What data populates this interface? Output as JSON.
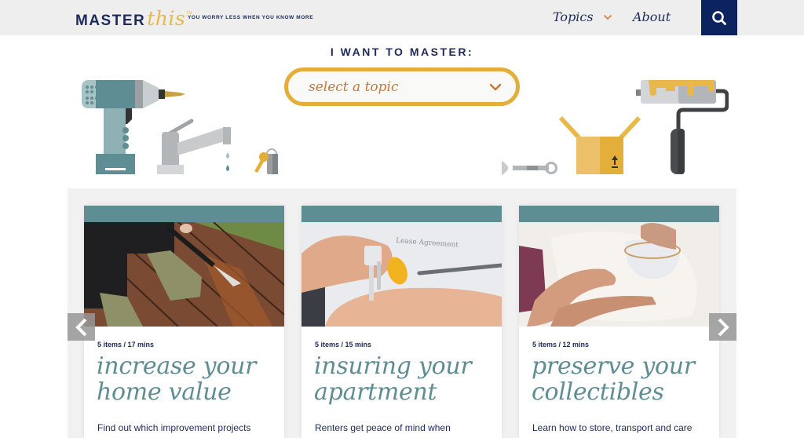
{
  "header": {
    "logo_master": "MASTER",
    "logo_this": "this",
    "logo_tm": "TM",
    "tagline": "YOU WORRY LESS WHEN YOU KNOW MORE",
    "nav": {
      "topics_label": "Topics",
      "about_label": "About"
    },
    "search_icon": "search-icon"
  },
  "hero": {
    "heading": "I WANT TO MASTER:",
    "select_placeholder": "select a topic",
    "illustrations": [
      "drill",
      "faucet",
      "keys",
      "wrench",
      "box",
      "paint-roller"
    ]
  },
  "carousel": {
    "prev_icon": "chevron-left-icon",
    "next_icon": "chevron-right-icon",
    "cards": [
      {
        "meta": "5 items  /  17 mins",
        "title": "increase your home value",
        "description": "Find out which improvement projects",
        "image": "power-washing-deck"
      },
      {
        "meta": "5 items  /  15 mins",
        "title": "insuring your apartment",
        "description": "Renters get peace of mind when",
        "image": "keys-lease-agreement"
      },
      {
        "meta": "5 items  /  12 mins",
        "title": "preserve your collectibles",
        "description": "Learn how to store, transport and care",
        "image": "teacup-in-tissue"
      }
    ]
  },
  "colors": {
    "navy": "#1d2a5b",
    "search_bg": "#0b2460",
    "gold": "#e4ae3b",
    "orange": "#c6773a",
    "teal": "#5f8d94",
    "header_bg": "#eeeeee",
    "band_bg": "#f1f1f1"
  }
}
